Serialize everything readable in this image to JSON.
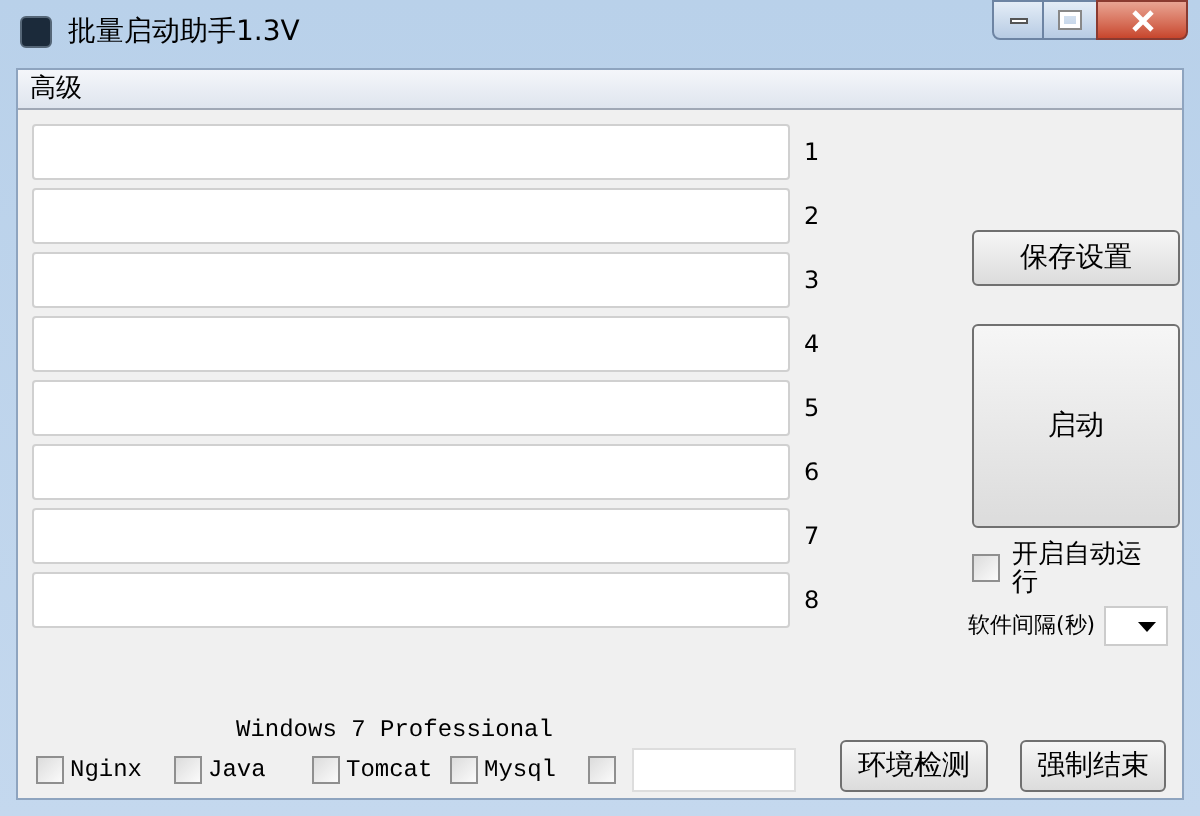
{
  "window": {
    "title": "批量启动助手1.3V"
  },
  "tabs": [
    {
      "label": "高级",
      "selected": true
    }
  ],
  "slots": [
    {
      "number": "1"
    },
    {
      "number": "2"
    },
    {
      "number": "3"
    },
    {
      "number": "4"
    },
    {
      "number": "5"
    },
    {
      "number": "6"
    },
    {
      "number": "7"
    },
    {
      "number": "8"
    }
  ],
  "save_button": "保存设置",
  "start_button": "启动",
  "autostart": {
    "label": "开启自动运行",
    "checked": false
  },
  "interval": {
    "label": "软件间隔(秒)"
  },
  "os_label": "Windows 7 Professional",
  "services": [
    {
      "label": "Nginx",
      "checked": false
    },
    {
      "label": "Java",
      "checked": false
    },
    {
      "label": "Tomcat",
      "checked": false
    },
    {
      "label": "Mysql",
      "checked": false
    },
    {
      "checked": false
    }
  ],
  "bottom_buttons": [
    "环境检测",
    "强制结束"
  ]
}
